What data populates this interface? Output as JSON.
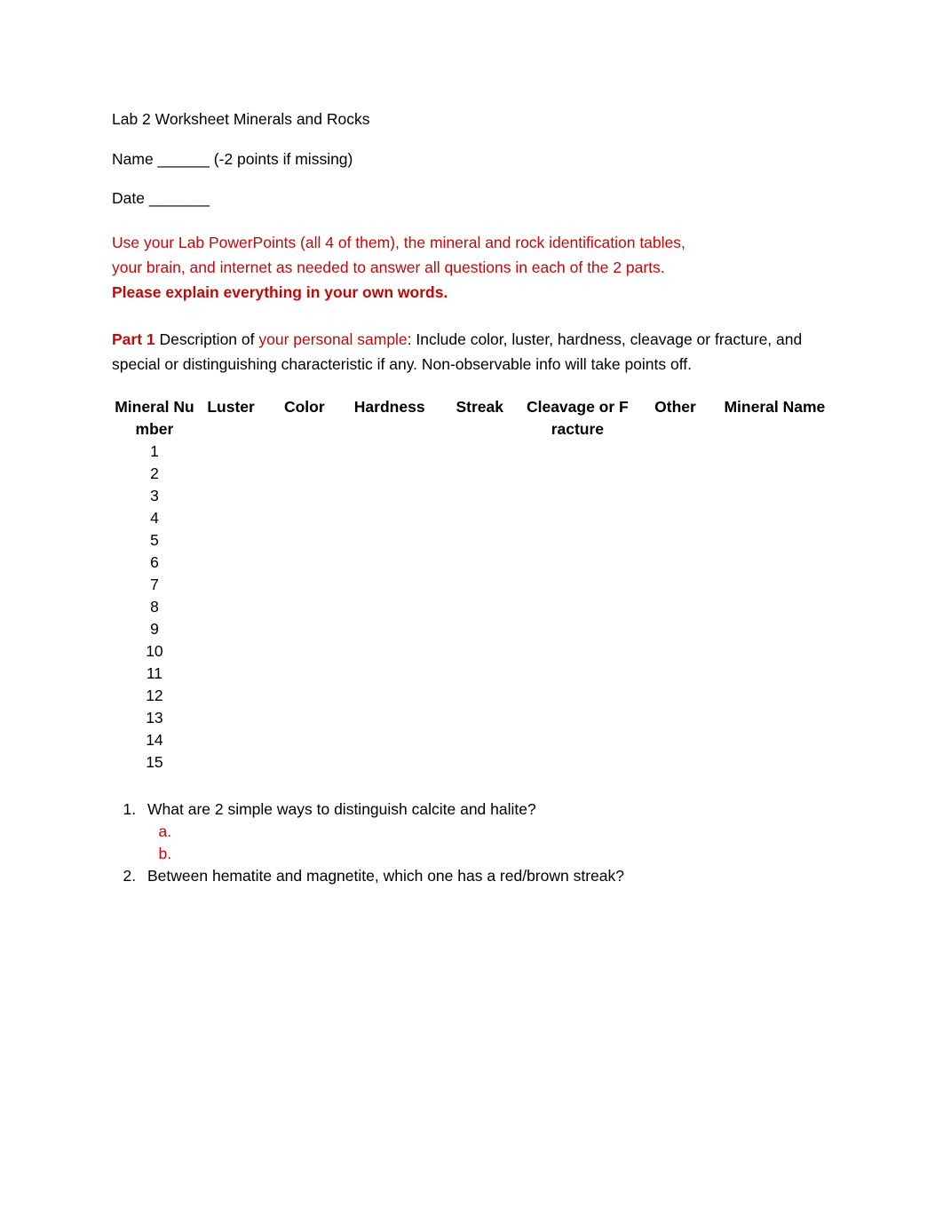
{
  "document": {
    "title": "Lab 2 Worksheet Minerals and Rocks",
    "name_line": "Name ______ (-2 points if missing)",
    "date_line": "Date _______",
    "instructions": {
      "line1": "Use your Lab PowerPoints (all 4 of them), the mineral and rock identification tables,",
      "line2": "your brain, and internet as needed to answer all questions in each of the 2 parts.",
      "line3_bold": "Please explain everything in your own words.",
      "color": "#C00A0A"
    },
    "part1": {
      "label": "Part 1",
      "text_before": " Description of ",
      "highlight": "your personal sample",
      "text_after": ": Include color, luster, hardness, cleavage or fracture, and special or distinguishing characteristic if any. Non-observable info will take points off."
    },
    "table": {
      "headers": [
        "Mineral Number",
        "Luster",
        "Color",
        "Hardness",
        "Streak",
        "Cleavage or Fracture",
        "Other",
        "Mineral Name"
      ],
      "rows": [
        {
          "number": "1",
          "luster": "",
          "color": "",
          "hardness": "",
          "streak": "",
          "cleavage": "",
          "other": "",
          "name": ""
        },
        {
          "number": "2",
          "luster": "",
          "color": "",
          "hardness": "",
          "streak": "",
          "cleavage": "",
          "other": "",
          "name": ""
        },
        {
          "number": "3",
          "luster": "",
          "color": "",
          "hardness": "",
          "streak": "",
          "cleavage": "",
          "other": "",
          "name": ""
        },
        {
          "number": "4",
          "luster": "",
          "color": "",
          "hardness": "",
          "streak": "",
          "cleavage": "",
          "other": "",
          "name": ""
        },
        {
          "number": "5",
          "luster": "",
          "color": "",
          "hardness": "",
          "streak": "",
          "cleavage": "",
          "other": "",
          "name": ""
        },
        {
          "number": "6",
          "luster": "",
          "color": "",
          "hardness": "",
          "streak": "",
          "cleavage": "",
          "other": "",
          "name": ""
        },
        {
          "number": "7",
          "luster": "",
          "color": "",
          "hardness": "",
          "streak": "",
          "cleavage": "",
          "other": "",
          "name": ""
        },
        {
          "number": "8",
          "luster": "",
          "color": "",
          "hardness": "",
          "streak": "",
          "cleavage": "",
          "other": "",
          "name": ""
        },
        {
          "number": "9",
          "luster": "",
          "color": "",
          "hardness": "",
          "streak": "",
          "cleavage": "",
          "other": "",
          "name": ""
        },
        {
          "number": "10",
          "luster": "",
          "color": "",
          "hardness": "",
          "streak": "",
          "cleavage": "",
          "other": "",
          "name": ""
        },
        {
          "number": "11",
          "luster": "",
          "color": "",
          "hardness": "",
          "streak": "",
          "cleavage": "",
          "other": "",
          "name": ""
        },
        {
          "number": "12",
          "luster": "",
          "color": "",
          "hardness": "",
          "streak": "",
          "cleavage": "",
          "other": "",
          "name": ""
        },
        {
          "number": "13",
          "luster": "",
          "color": "",
          "hardness": "",
          "streak": "",
          "cleavage": "",
          "other": "",
          "name": ""
        },
        {
          "number": "14",
          "luster": "",
          "color": "",
          "hardness": "",
          "streak": "",
          "cleavage": "",
          "other": "",
          "name": ""
        },
        {
          "number": "15",
          "luster": "",
          "color": "",
          "hardness": "",
          "streak": "",
          "cleavage": "",
          "other": "",
          "name": ""
        }
      ]
    },
    "questions": [
      {
        "text": "What are 2 simple ways to distinguish calcite and halite?",
        "subitems": [
          "",
          ""
        ]
      },
      {
        "text": "Between hematite and magnetite, which one has a red/brown streak?",
        "subitems": []
      }
    ]
  }
}
